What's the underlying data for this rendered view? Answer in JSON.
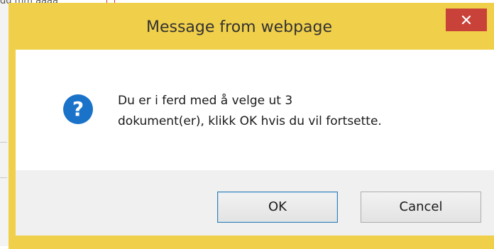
{
  "background": {
    "top_text": "dd mm åååå"
  },
  "dialog": {
    "title": "Message from webpage",
    "close_label": "×",
    "icon": "question-icon",
    "message_line1": "Du er i ferd med å velge ut 3",
    "message_line2": "dokument(er), klikk OK hvis du vil fortsette.",
    "ok_label": "OK",
    "cancel_label": "Cancel"
  },
  "colors": {
    "frame": "#f0cf4a",
    "close_button": "#c9423a",
    "icon_blue": "#1a73c9",
    "footer": "#f0f0f0"
  }
}
